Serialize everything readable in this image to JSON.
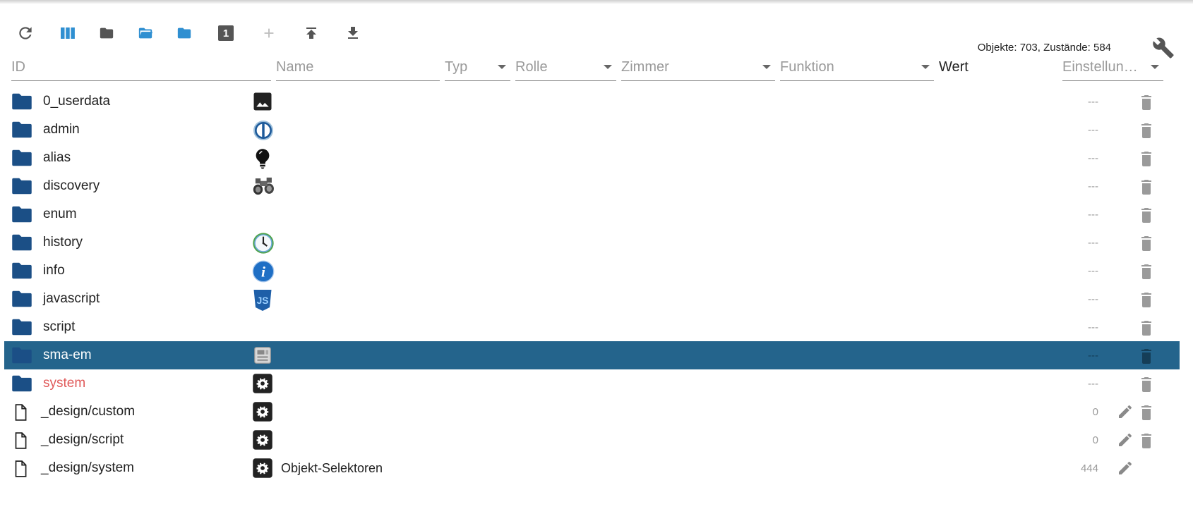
{
  "toolbar": {
    "buttons": [
      {
        "name": "refresh-icon"
      },
      {
        "name": "columns-icon"
      },
      {
        "name": "folder-icon"
      },
      {
        "name": "folder-open-icon"
      },
      {
        "name": "folder-blue-icon"
      },
      {
        "name": "one-icon",
        "label": "1"
      },
      {
        "name": "plus-icon"
      },
      {
        "name": "upload-icon"
      },
      {
        "name": "download-icon"
      }
    ],
    "stats": "Objekte: 703, Zustände: 584"
  },
  "filters": {
    "id": "ID",
    "name": "Name",
    "typ": "Typ",
    "rolle": "Rolle",
    "zimmer": "Zimmer",
    "funktion": "Funktion",
    "wert": "Wert",
    "einstellungen": "Einstellun…"
  },
  "colors": {
    "folder": "#1b4f86",
    "selected": "#24648c",
    "red": "#e05a5a",
    "toolbar_blue": "#2f8fd1"
  },
  "rows": [
    {
      "id": "0_userdata",
      "type": "folder",
      "name_icon": "image-icon",
      "name": "",
      "value": "---",
      "edit": false,
      "trash": true
    },
    {
      "id": "admin",
      "type": "folder",
      "name_icon": "iobroker-icon",
      "name": "",
      "value": "---",
      "edit": false,
      "trash": true
    },
    {
      "id": "alias",
      "type": "folder",
      "name_icon": "lightbulb-icon",
      "name": "",
      "value": "---",
      "edit": false,
      "trash": true
    },
    {
      "id": "discovery",
      "type": "folder",
      "name_icon": "binoculars-icon",
      "name": "",
      "value": "---",
      "edit": false,
      "trash": true
    },
    {
      "id": "enum",
      "type": "folder",
      "name_icon": "",
      "name": "",
      "value": "---",
      "edit": false,
      "trash": true
    },
    {
      "id": "history",
      "type": "folder",
      "name_icon": "clock-icon",
      "name": "",
      "value": "---",
      "edit": false,
      "trash": true
    },
    {
      "id": "info",
      "type": "folder",
      "name_icon": "info-icon",
      "name": "",
      "value": "---",
      "edit": false,
      "trash": true
    },
    {
      "id": "javascript",
      "type": "folder",
      "name_icon": "js-icon",
      "name": "",
      "value": "---",
      "edit": false,
      "trash": true
    },
    {
      "id": "script",
      "type": "folder",
      "name_icon": "",
      "name": "",
      "value": "---",
      "edit": false,
      "trash": true
    },
    {
      "id": "sma-em",
      "type": "folder",
      "name_icon": "meter-icon",
      "name": "",
      "value": "---",
      "edit": false,
      "trash": true,
      "selected": true
    },
    {
      "id": "system",
      "type": "folder",
      "name_icon": "gear-icon",
      "name": "",
      "value": "---",
      "edit": false,
      "trash": true,
      "red": true
    },
    {
      "id": "_design/custom",
      "type": "file",
      "name_icon": "gear-icon",
      "name": "",
      "value": "0",
      "edit": true,
      "trash": true
    },
    {
      "id": "_design/script",
      "type": "file",
      "name_icon": "gear-icon",
      "name": "",
      "value": "0",
      "edit": true,
      "trash": true
    },
    {
      "id": "_design/system",
      "type": "file",
      "name_icon": "gear-icon",
      "name": "Objekt-Selektoren",
      "value": "444",
      "edit": true,
      "trash": false
    }
  ]
}
